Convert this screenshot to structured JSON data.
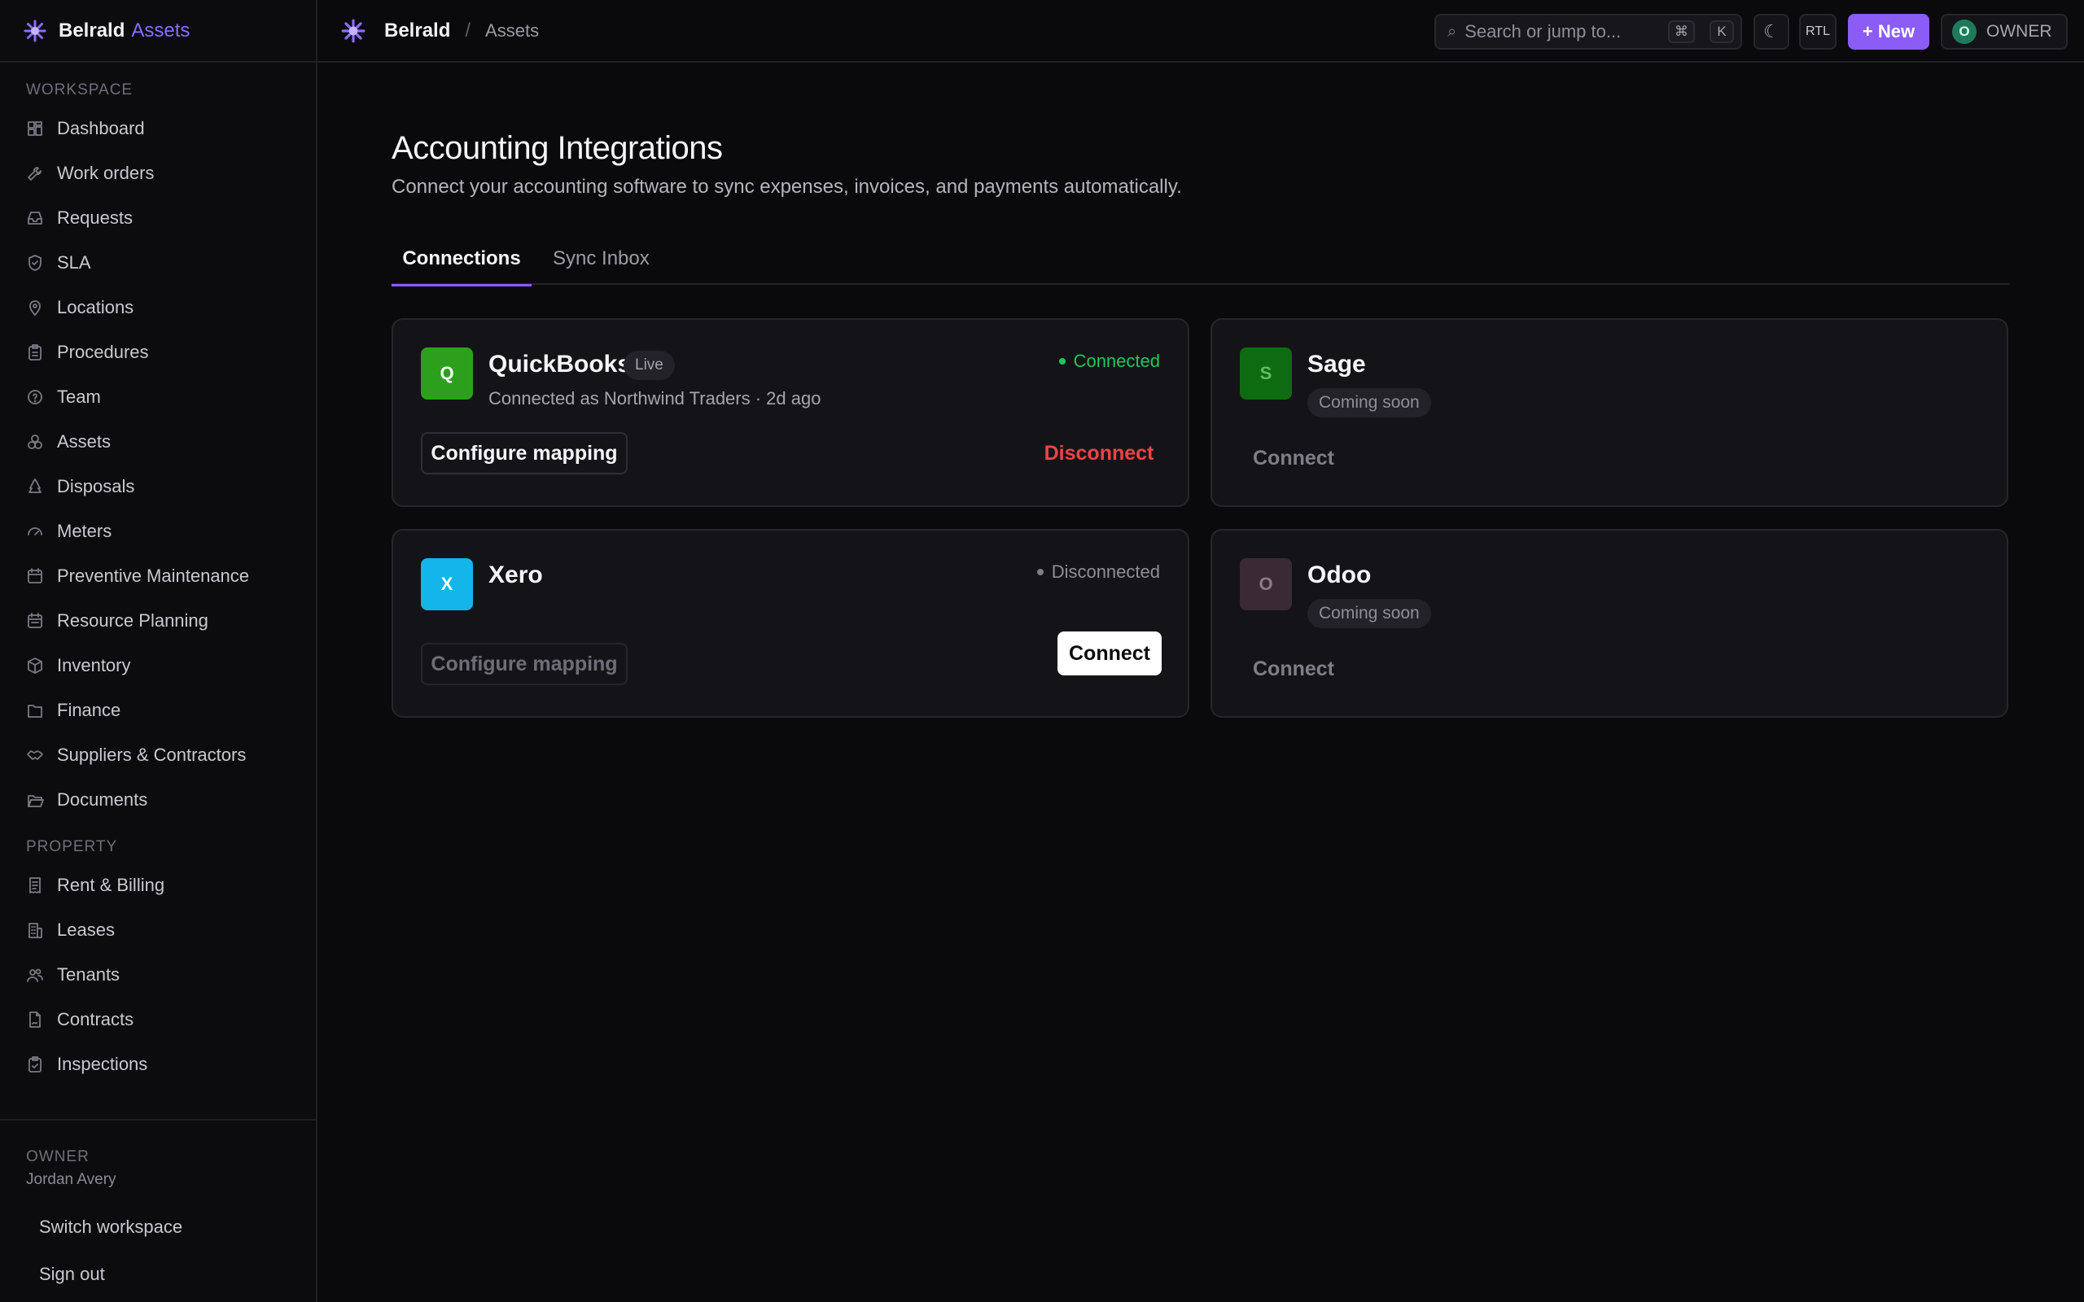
{
  "brand": {
    "name": "Belrald",
    "product": "Assets",
    "accent": "#8b6cff"
  },
  "sidebar": {
    "sections": [
      {
        "title": "WORKSPACE",
        "items": [
          {
            "label": "Dashboard",
            "icon": "dashboard-icon"
          },
          {
            "label": "Work orders",
            "icon": "wrench-icon"
          },
          {
            "label": "Requests",
            "icon": "inbox-icon"
          },
          {
            "label": "SLA",
            "icon": "shield-icon"
          },
          {
            "label": "Locations",
            "icon": "map-pin-icon"
          },
          {
            "label": "Procedures",
            "icon": "clipboard-icon"
          },
          {
            "label": "Team",
            "icon": "help-circle-icon"
          },
          {
            "label": "Assets",
            "icon": "boxes-icon"
          },
          {
            "label": "Disposals",
            "icon": "recycle-icon"
          },
          {
            "label": "Meters",
            "icon": "gauge-icon"
          },
          {
            "label": "Preventive Maintenance",
            "icon": "calendar-icon"
          },
          {
            "label": "Resource Planning",
            "icon": "calendar-range-icon"
          },
          {
            "label": "Inventory",
            "icon": "package-icon"
          },
          {
            "label": "Finance",
            "icon": "folder-icon"
          },
          {
            "label": "Suppliers & Contractors",
            "icon": "handshake-icon"
          },
          {
            "label": "Documents",
            "icon": "folder-open-icon"
          }
        ]
      },
      {
        "title": "PROPERTY",
        "items": [
          {
            "label": "Rent & Billing",
            "icon": "receipt-icon"
          },
          {
            "label": "Leases",
            "icon": "building-icon"
          },
          {
            "label": "Tenants",
            "icon": "users-icon"
          },
          {
            "label": "Contracts",
            "icon": "file-signature-icon"
          },
          {
            "label": "Inspections",
            "icon": "clipboard-check-icon"
          }
        ]
      }
    ],
    "footer": {
      "role": "OWNER",
      "user": "Jordan Avery",
      "switch_label": "Switch workspace",
      "signout_label": "Sign out"
    }
  },
  "topbar": {
    "breadcrumb_root": "Belrald",
    "breadcrumb_sep": "/",
    "breadcrumb_current": "Assets",
    "search_placeholder": "Search or jump to...",
    "shortcut_keys": [
      "⌘",
      "K"
    ],
    "theme_icon": "moon-icon",
    "rtl_label": "RTL",
    "new_label": "+ New",
    "new_color": "#8b5cf6",
    "owner_initial": "O",
    "owner_label": "OWNER"
  },
  "page": {
    "title": "Accounting Integrations",
    "subtitle": "Connect your accounting software to sync expenses, invoices, and payments automatically.",
    "tabs": [
      {
        "label": "Connections",
        "active": true
      },
      {
        "label": "Sync Inbox",
        "active": false
      }
    ]
  },
  "integrations": {
    "quickbooks": {
      "initial": "Q",
      "name": "QuickBooks",
      "badge": "Live",
      "meta": "Connected as Northwind Traders · 2d ago",
      "status": "Connected",
      "status_color": "#22c55e",
      "configure_label": "Configure mapping",
      "action_label": "Disconnect",
      "tile_color": "#2ca01c"
    },
    "sage": {
      "initial": "S",
      "name": "Sage",
      "badge": "Coming soon",
      "action_label": "Connect",
      "tile_color": "#0f6b12"
    },
    "xero": {
      "initial": "X",
      "name": "Xero",
      "status": "Disconnected",
      "status_color": "#7e7e88",
      "configure_label": "Configure mapping",
      "action_label": "Connect",
      "tile_color": "#13b5ea"
    },
    "odoo": {
      "initial": "O",
      "name": "Odoo",
      "badge": "Coming soon",
      "action_label": "Connect",
      "tile_color": "#3a2a35"
    }
  }
}
